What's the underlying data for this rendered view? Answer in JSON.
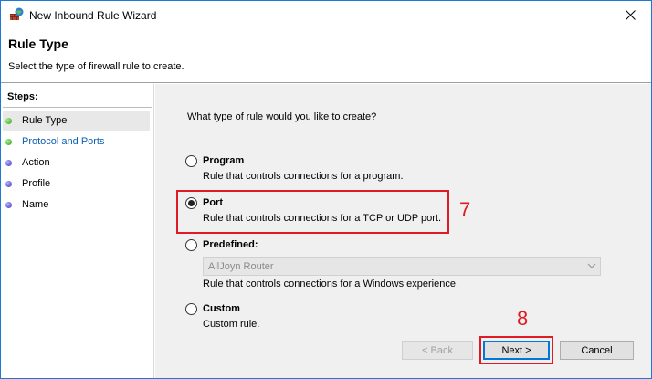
{
  "window": {
    "title": "New Inbound Rule Wizard"
  },
  "header": {
    "title": "Rule Type",
    "subtitle": "Select the type of firewall rule to create."
  },
  "sidebar": {
    "steps_label": "Steps:",
    "items": [
      {
        "label": "Rule Type",
        "state": "active",
        "dot": "green"
      },
      {
        "label": "Protocol and Ports",
        "state": "link",
        "dot": "green"
      },
      {
        "label": "Action",
        "state": "normal",
        "dot": "blue"
      },
      {
        "label": "Profile",
        "state": "normal",
        "dot": "blue"
      },
      {
        "label": "Name",
        "state": "normal",
        "dot": "blue"
      }
    ]
  },
  "main": {
    "question": "What type of rule would you like to create?",
    "options": [
      {
        "title": "Program",
        "desc": "Rule that controls connections for a program.",
        "checked": false
      },
      {
        "title": "Port",
        "desc": "Rule that controls connections for a TCP or UDP port.",
        "checked": true
      },
      {
        "title": "Predefined:",
        "desc": "Rule that controls connections for a Windows experience.",
        "checked": false
      },
      {
        "title": "Custom",
        "desc": "Custom rule.",
        "checked": false
      }
    ],
    "predefined_dropdown": {
      "value": "AllJoyn Router"
    }
  },
  "annotations": {
    "step7": "7",
    "step8": "8",
    "color": "#e01b24"
  },
  "buttons": {
    "back": "< Back",
    "next": "Next >",
    "cancel": "Cancel"
  }
}
